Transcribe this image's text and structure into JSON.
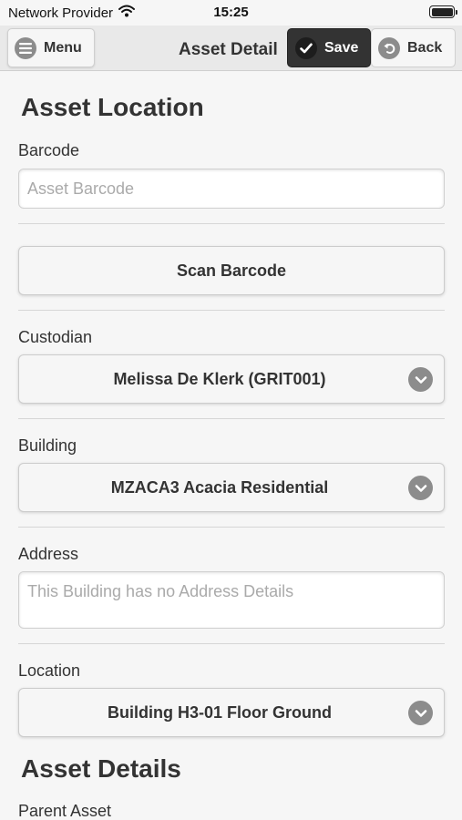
{
  "statusbar": {
    "carrier": "Network Provider",
    "time": "15:25",
    "icons": [
      "wifi-icon",
      "battery-icon"
    ]
  },
  "header": {
    "title": "Asset Detail",
    "menu_label": "Menu",
    "save_label": "Save",
    "back_label": "Back",
    "icons": {
      "menu": "hamburger-icon",
      "save": "checkmark-icon",
      "back": "back-arrow-icon"
    }
  },
  "asset_location": {
    "title": "Asset Location",
    "barcode": {
      "label": "Barcode",
      "value": "",
      "placeholder": "Asset Barcode"
    },
    "scan_button": "Scan Barcode",
    "custodian": {
      "label": "Custodian",
      "value": "Melissa De Klerk (GRIT001)"
    },
    "building": {
      "label": "Building",
      "value": "MZACA3 Acacia Residential"
    },
    "address": {
      "label": "Address",
      "value": "",
      "placeholder": "This Building has no Address Details"
    },
    "location": {
      "label": "Location",
      "value": "Building H3-01 Floor Ground"
    }
  },
  "asset_details": {
    "title": "Asset Details",
    "parent_asset": {
      "label": "Parent Asset"
    }
  },
  "colors": {
    "background": "#f6f6f6",
    "header": "#e9e9e9",
    "save_button": "#333333",
    "chevron_circle": "#8c8c8c"
  }
}
